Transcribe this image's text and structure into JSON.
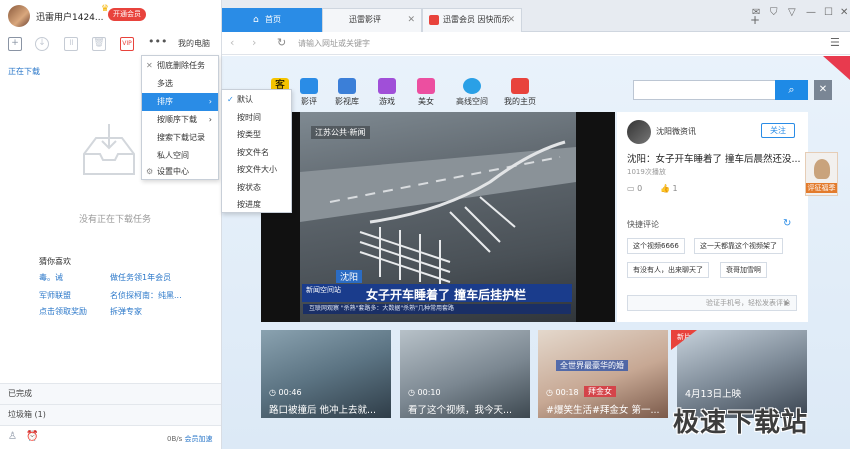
{
  "user": {
    "name": "迅雷用户1424...",
    "vip_button": "开通会员",
    "my_computer": "我的电脑"
  },
  "left": {
    "section": "正在下载",
    "empty_text": "没有正在下载任务",
    "guess_title": "猜你喜欢",
    "links": [
      "毒。诫",
      "做任务领1年会员",
      "军师联盟",
      "名侦探柯南：纯黑...",
      "点击领取奖励",
      "拆弹专家"
    ],
    "completed": "已完成",
    "trash": "垃圾箱 (1)",
    "speed": "0B/s",
    "accelerate": "会员加速"
  },
  "menu": {
    "items": [
      "彻底删除任务",
      "多选",
      "排序",
      "按顺序下载",
      "搜索下载记录",
      "私人空间",
      "设置中心"
    ],
    "sort_items": [
      "默认",
      "按时间",
      "按类型",
      "按文件名",
      "按文件大小",
      "按状态",
      "按进度"
    ],
    "sort_selected": "默认"
  },
  "tabs": [
    {
      "label": "首页"
    },
    {
      "label": "迅雷影评"
    },
    {
      "label": "迅雷会员 因快而乐"
    }
  ],
  "address": {
    "placeholder": "请输入网址或关键字"
  },
  "nav": [
    {
      "label": "",
      "color": "#f5c400"
    },
    {
      "label": "影评",
      "color": "#2a8ce6"
    },
    {
      "label": "影视库",
      "color": "#3b7fd8"
    },
    {
      "label": "游戏",
      "color": "#a04fd8"
    },
    {
      "label": "美女",
      "color": "#ec4fa0"
    },
    {
      "label": "高线空间",
      "color": "#2aa0e6"
    },
    {
      "label": "我的主页",
      "color": "#e8433c"
    }
  ],
  "nav_first_char": "客",
  "video": {
    "channel": "江苏公共·新闻",
    "city": "沈阳",
    "news_tag": "新闻空间站",
    "title": "女子开车睡着了 撞车后挂护栏",
    "ticker": "互联网观察 \"杀熟\"套路多：大数据\"杀熟\"几种常用套路"
  },
  "side": {
    "account": "沈阳微资讯",
    "follow": "关注",
    "headline": "沈阳：女子开车睡着了 撞车后晨然还没...",
    "plays": "1019次播放",
    "comments": "0",
    "likes": "1",
    "quick_comment": "快捷评论",
    "tags": [
      "这个视频6666",
      "这一天都靠这个视频架了",
      "有没有人，出来聊天了",
      "衰哥加雪啊"
    ],
    "verify": "验证手机号，轻松发表评论"
  },
  "banner": {
    "text": "评征福季"
  },
  "thumbs": [
    {
      "duration": "00:46",
      "caption": "路口被撞后 他冲上去就..."
    },
    {
      "duration": "00:10",
      "caption": "看了这个视频，我今天..."
    },
    {
      "duration": "00:18",
      "caption": "#爆笑生活#拜金女 第一..."
    },
    {
      "duration": "",
      "caption": "4月13日上映"
    }
  ],
  "thumb3_overlay": "全世界最豪华的婚",
  "thumb3_sub": "拜金女",
  "new_badge": "新片",
  "watermark": "极速下载站"
}
